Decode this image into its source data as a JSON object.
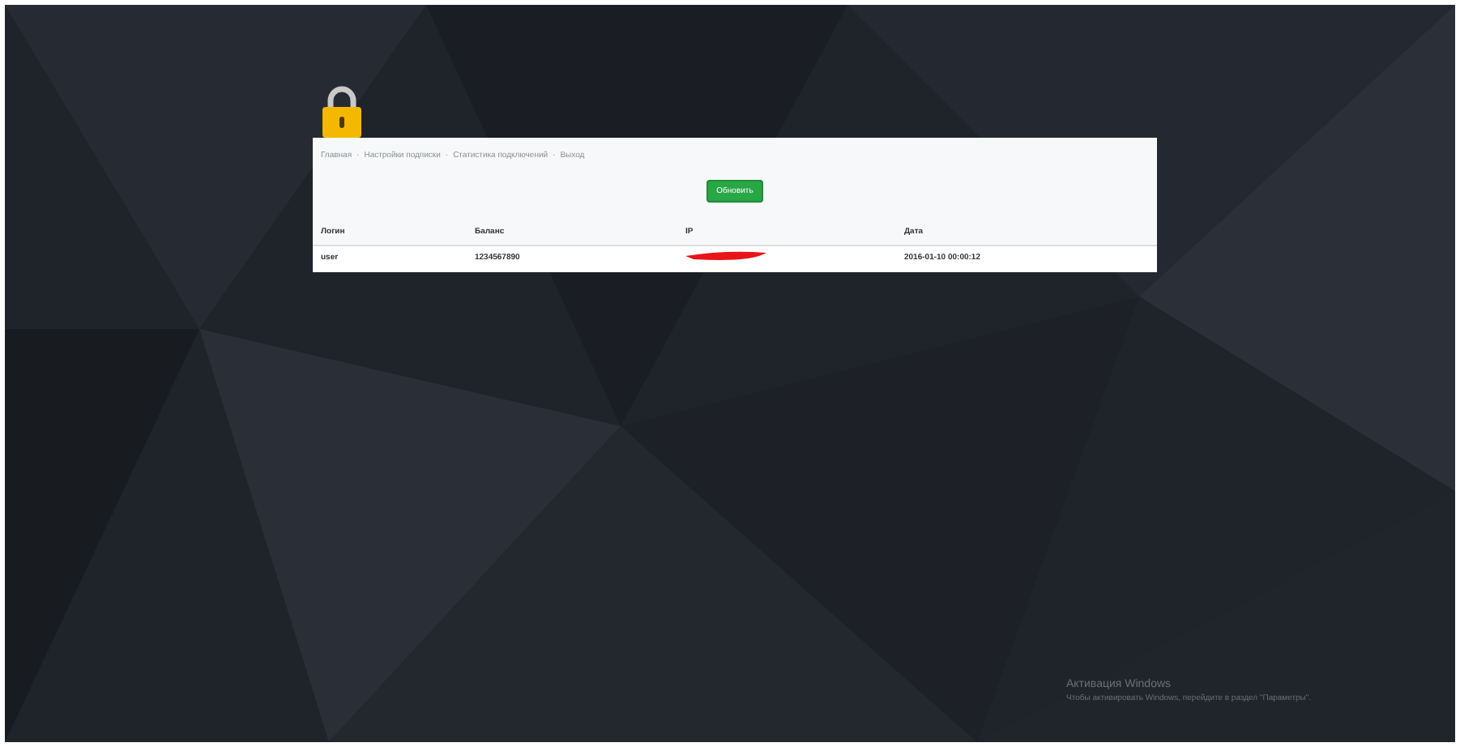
{
  "nav": [
    "Главная",
    "Настройки подписки",
    "Статистика подключений",
    "Выход"
  ],
  "nav_separator": "·",
  "button": "Обновить",
  "table": {
    "columns": [
      "Логин",
      "Баланс",
      "IP",
      "Дата"
    ],
    "rows": [
      {
        "cells": [
          {
            "kind": "text",
            "text": "user"
          },
          {
            "kind": "text",
            "text": "1234567890"
          },
          {
            "kind": "redacted"
          },
          {
            "kind": "text",
            "text": "2016-01-10 00:00:12"
          }
        ]
      }
    ]
  },
  "activation": {
    "title": "Активация Windows",
    "text": "Чтобы активировать Windows, перейдите в раздел \"Параметры\"."
  }
}
